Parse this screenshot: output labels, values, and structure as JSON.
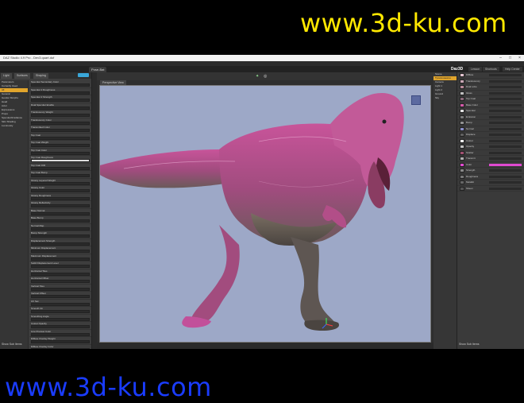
{
  "watermark": {
    "top": "www.3d-ku.com",
    "bottom": "www.3d-ku.com"
  },
  "window": {
    "title": "DAZ Studio 4.9 Pro - Dev3.quart.duf"
  },
  "menu": [
    "File",
    "Edit",
    "Create",
    "Tools",
    "Render",
    "Window",
    "Help"
  ],
  "toolbar": {
    "tab": "Pose-Bat",
    "logo": "Daz3D",
    "lesson_tabs": [
      "Lesson",
      "Shortcuts",
      "Help Center"
    ]
  },
  "left_panel": {
    "tabs": [
      "Light",
      "Surfaces",
      "Shaping"
    ],
    "tree": [
      {
        "label": "Parameters",
        "selected": false
      },
      {
        "label": "Currently Used",
        "selected": false
      },
      {
        "label": "All",
        "selected": true
      },
      {
        "label": "General",
        "selected": false
      },
      {
        "label": "Gender Morphs",
        "selected": false
      },
      {
        "label": "Head",
        "selected": false
      },
      {
        "label": "Actor",
        "selected": false
      },
      {
        "label": "Expressions",
        "selected": false
      },
      {
        "label": "Props",
        "selected": false
      },
      {
        "label": "Specular/Irradiance",
        "selected": false
      },
      {
        "label": "Skin Shading",
        "selected": false
      },
      {
        "label": "Luminosity",
        "selected": false
      }
    ],
    "props": [
      "Specular Secondary Color",
      "Specular 2 Roughness",
      "Specular 2 Strength",
      "Dual Specular Enable",
      "Translucency Weight",
      "Translucency Color",
      "Transmitted Color",
      "Top Coat",
      "Top Coat Weight",
      "Top Coat Color",
      "Top Coat Roughness",
      "Top Coat IOR",
      "Top Coat Bump",
      "Glossy Layered Weight",
      "Glossy Color",
      "Glossy Roughness",
      "Glossy Reflectivity",
      "Base Normal",
      "Base Bump",
      "Normal Map",
      "Bump Strength",
      "Displacement Strength",
      "Minimum Displacement",
      "Maximum Displacement",
      "SubD Displacement Level",
      "Horizontal Tiles",
      "Horizontal Offset",
      "Vertical Tiles",
      "Vertical Offset",
      "UV Set",
      "Smooth On",
      "Smoothing Angle",
      "Cutout Opacity",
      "Line Preview Color",
      "Diffuse Overlay Weight",
      "Diffuse Overlay Color",
      "Opacity",
      "Bump Mode"
    ],
    "footer": "Show Sub Items"
  },
  "viewport": {
    "label": "Perspective View",
    "camera_icon": "camera-icon",
    "aux_label": "Aux"
  },
  "right_tree": [
    {
      "label": "Scene",
      "selected": false
    },
    {
      "label": "Tyrannosaurus",
      "selected": true
    },
    {
      "label": "Camera",
      "selected": false
    },
    {
      "label": "Light 1",
      "selected": false
    },
    {
      "label": "Light 2",
      "selected": false
    },
    {
      "label": "Ground",
      "selected": false
    },
    {
      "label": "Sky",
      "selected": false
    }
  ],
  "right_panel": {
    "rows": [
      {
        "label": "Diffuse",
        "swatch": "#e2c4d0",
        "pink": false
      },
      {
        "label": "Translucency",
        "swatch": "#c9a6b4",
        "pink": false
      },
      {
        "label": "Dual Lobe",
        "swatch": "#b98a9a",
        "pink": false
      },
      {
        "label": "Gloss",
        "swatch": "#bfbfbf",
        "pink": false
      },
      {
        "label": "Top Coat",
        "swatch": "#8a6a7a",
        "pink": false
      },
      {
        "label": "Base Color",
        "swatch": "#d25aa8",
        "pink": false
      },
      {
        "label": "Specular",
        "swatch": "#e0e0e0",
        "pink": false
      },
      {
        "label": "Emission",
        "swatch": "#777777",
        "pink": false
      },
      {
        "label": "Bump",
        "swatch": "#909090",
        "pink": false
      },
      {
        "label": "Normal",
        "swatch": "#8a8fc8",
        "pink": false
      },
      {
        "label": "Displace",
        "swatch": "#606060",
        "pink": false
      },
      {
        "label": "Cutout",
        "swatch": "#f0f0f0",
        "pink": false
      },
      {
        "label": "Opacity",
        "swatch": "#c0c0c0",
        "pink": false
      },
      {
        "label": "Scatter",
        "swatch": "#a05070",
        "pink": false
      },
      {
        "label": "Transmit",
        "swatch": "#b0b0b0",
        "pink": false
      },
      {
        "label": "Color",
        "swatch": "#e04ad0",
        "pink": true
      },
      {
        "label": "Strength",
        "swatch": "#888888",
        "pink": false
      },
      {
        "label": "Roughness",
        "swatch": "#777777",
        "pink": false
      },
      {
        "label": "Metallic",
        "swatch": "#666666",
        "pink": false
      },
      {
        "label": "Sheen",
        "swatch": "#555555",
        "pink": false
      }
    ],
    "footer": "Show Sub Items"
  },
  "colors": {
    "accent_orange": "#e1a52c",
    "accent_blue": "#3aa7d9",
    "accent_pink": "#e04ad0",
    "viewport_bg": "#9da8c7"
  }
}
